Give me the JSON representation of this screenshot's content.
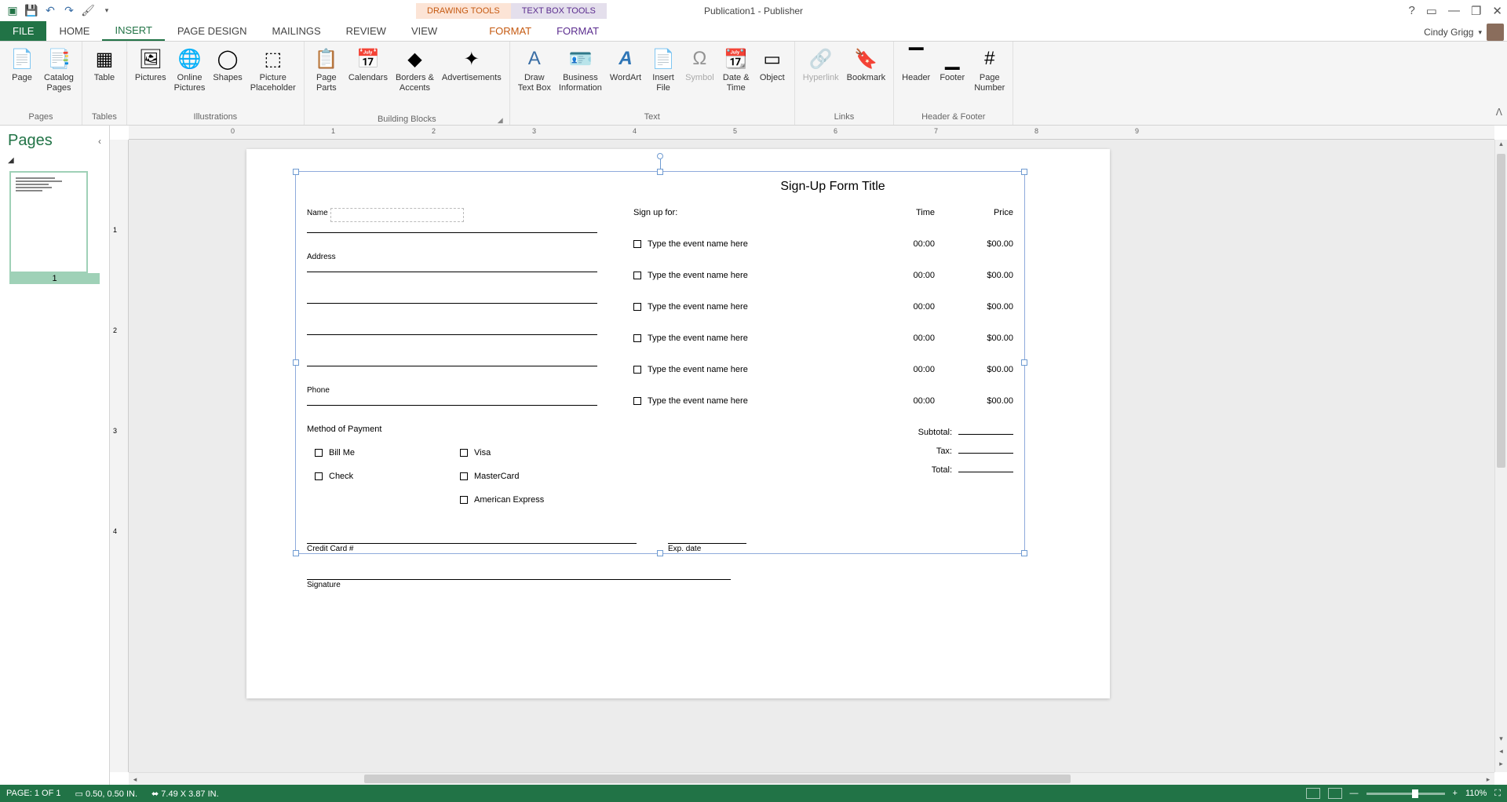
{
  "titlebar": {
    "app_title": "Publication1 - Publisher",
    "context_tabs": {
      "drawing": "DRAWING TOOLS",
      "textbox": "TEXT BOX TOOLS"
    },
    "user_name": "Cindy Grigg"
  },
  "tabs": {
    "file": "FILE",
    "home": "HOME",
    "insert": "INSERT",
    "page_design": "PAGE DESIGN",
    "mailings": "MAILINGS",
    "review": "REVIEW",
    "view": "VIEW",
    "format1": "FORMAT",
    "format2": "FORMAT"
  },
  "ribbon": {
    "pages": {
      "label": "Pages",
      "page": "Page",
      "catalog": "Catalog\nPages"
    },
    "tables": {
      "label": "Tables",
      "table": "Table"
    },
    "illustrations": {
      "label": "Illustrations",
      "pictures": "Pictures",
      "online": "Online\nPictures",
      "shapes": "Shapes",
      "placeholder": "Picture\nPlaceholder"
    },
    "blocks": {
      "label": "Building Blocks",
      "parts": "Page\nParts",
      "calendars": "Calendars",
      "borders": "Borders &\nAccents",
      "ads": "Advertisements"
    },
    "text": {
      "label": "Text",
      "draw": "Draw\nText Box",
      "business": "Business\nInformation",
      "wordart": "WordArt",
      "insertfile": "Insert\nFile",
      "symbol": "Symbol",
      "datetime": "Date &\nTime",
      "object": "Object"
    },
    "links": {
      "label": "Links",
      "hyperlink": "Hyperlink",
      "bookmark": "Bookmark"
    },
    "hf": {
      "label": "Header & Footer",
      "header": "Header",
      "footer": "Footer",
      "pagenum": "Page\nNumber"
    }
  },
  "pages_panel": {
    "title": "Pages",
    "page_num": "1"
  },
  "ruler_h": [
    "0",
    "1",
    "2",
    "3",
    "4",
    "5",
    "6",
    "7",
    "8",
    "9"
  ],
  "ruler_v": [
    "1",
    "2",
    "3",
    "4"
  ],
  "form": {
    "title": "Sign-Up Form Title",
    "labels": {
      "name": "Name",
      "address": "Address",
      "phone": "Phone",
      "method": "Method of Payment",
      "cc": "Credit Card #",
      "exp": "Exp. date",
      "sig": "Signature"
    },
    "payments": {
      "billme": "Bill Me",
      "visa": "Visa",
      "check": "Check",
      "mc": "MasterCard",
      "amex": "American Express"
    },
    "signup_for": "Sign up for:",
    "cols": {
      "time": "Time",
      "price": "Price"
    },
    "event_placeholder": "Type the event name here",
    "time_val": "00:00",
    "price_val": "$00.00",
    "totals": {
      "subtotal": "Subtotal:",
      "tax": "Tax:",
      "total": "Total:"
    }
  },
  "status": {
    "page": "PAGE: 1 OF 1",
    "pos": "0.50, 0.50 IN.",
    "size": "7.49 X  3.87 IN.",
    "zoom": "110%"
  }
}
